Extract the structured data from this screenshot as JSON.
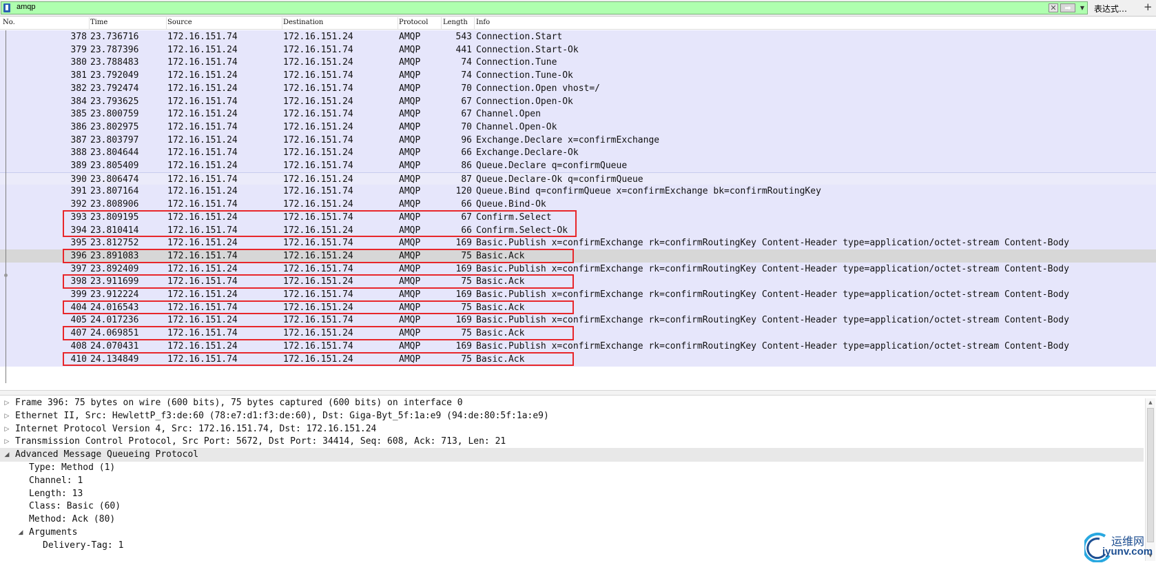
{
  "filter": {
    "value": "amqp",
    "clear_glyph": "✕",
    "apply_glyph": "➡",
    "history_glyph": "▼",
    "expression_label": "表达式…",
    "add_glyph": "+"
  },
  "columns": [
    "No.",
    "Time",
    "Source",
    "Destination",
    "Protocol",
    "Length",
    "Info"
  ],
  "packets": [
    {
      "no": "378",
      "time": "23.736716",
      "src": "172.16.151.74",
      "dst": "172.16.151.24",
      "proto": "AMQP",
      "len": "543",
      "info": "Connection.Start"
    },
    {
      "no": "379",
      "time": "23.787396",
      "src": "172.16.151.24",
      "dst": "172.16.151.74",
      "proto": "AMQP",
      "len": "441",
      "info": "Connection.Start-Ok"
    },
    {
      "no": "380",
      "time": "23.788483",
      "src": "172.16.151.74",
      "dst": "172.16.151.24",
      "proto": "AMQP",
      "len": "74",
      "info": "Connection.Tune"
    },
    {
      "no": "381",
      "time": "23.792049",
      "src": "172.16.151.24",
      "dst": "172.16.151.74",
      "proto": "AMQP",
      "len": "74",
      "info": "Connection.Tune-Ok"
    },
    {
      "no": "382",
      "time": "23.792474",
      "src": "172.16.151.24",
      "dst": "172.16.151.74",
      "proto": "AMQP",
      "len": "70",
      "info": "Connection.Open vhost=/"
    },
    {
      "no": "384",
      "time": "23.793625",
      "src": "172.16.151.74",
      "dst": "172.16.151.24",
      "proto": "AMQP",
      "len": "67",
      "info": "Connection.Open-Ok"
    },
    {
      "no": "385",
      "time": "23.800759",
      "src": "172.16.151.24",
      "dst": "172.16.151.74",
      "proto": "AMQP",
      "len": "67",
      "info": "Channel.Open"
    },
    {
      "no": "386",
      "time": "23.802975",
      "src": "172.16.151.74",
      "dst": "172.16.151.24",
      "proto": "AMQP",
      "len": "70",
      "info": "Channel.Open-Ok"
    },
    {
      "no": "387",
      "time": "23.803797",
      "src": "172.16.151.24",
      "dst": "172.16.151.74",
      "proto": "AMQP",
      "len": "96",
      "info": "Exchange.Declare x=confirmExchange"
    },
    {
      "no": "388",
      "time": "23.804644",
      "src": "172.16.151.74",
      "dst": "172.16.151.24",
      "proto": "AMQP",
      "len": "66",
      "info": "Exchange.Declare-Ok"
    },
    {
      "no": "389",
      "time": "23.805409",
      "src": "172.16.151.24",
      "dst": "172.16.151.74",
      "proto": "AMQP",
      "len": "86",
      "info": "Queue.Declare q=confirmQueue"
    },
    {
      "no": "390",
      "time": "23.806474",
      "src": "172.16.151.74",
      "dst": "172.16.151.24",
      "proto": "AMQP",
      "len": "87",
      "info": "Queue.Declare-Ok q=confirmQueue"
    },
    {
      "no": "391",
      "time": "23.807164",
      "src": "172.16.151.24",
      "dst": "172.16.151.74",
      "proto": "AMQP",
      "len": "120",
      "info": "Queue.Bind q=confirmQueue x=confirmExchange bk=confirmRoutingKey"
    },
    {
      "no": "392",
      "time": "23.808906",
      "src": "172.16.151.74",
      "dst": "172.16.151.24",
      "proto": "AMQP",
      "len": "66",
      "info": "Queue.Bind-Ok"
    },
    {
      "no": "393",
      "time": "23.809195",
      "src": "172.16.151.24",
      "dst": "172.16.151.74",
      "proto": "AMQP",
      "len": "67",
      "info": "Confirm.Select"
    },
    {
      "no": "394",
      "time": "23.810414",
      "src": "172.16.151.74",
      "dst": "172.16.151.24",
      "proto": "AMQP",
      "len": "66",
      "info": "Confirm.Select-Ok"
    },
    {
      "no": "395",
      "time": "23.812752",
      "src": "172.16.151.24",
      "dst": "172.16.151.74",
      "proto": "AMQP",
      "len": "169",
      "info": "Basic.Publish x=confirmExchange rk=confirmRoutingKey Content-Header type=application/octet-stream Content-Body"
    },
    {
      "no": "396",
      "time": "23.891083",
      "src": "172.16.151.74",
      "dst": "172.16.151.24",
      "proto": "AMQP",
      "len": "75",
      "info": "Basic.Ack"
    },
    {
      "no": "397",
      "time": "23.892409",
      "src": "172.16.151.24",
      "dst": "172.16.151.74",
      "proto": "AMQP",
      "len": "169",
      "info": "Basic.Publish x=confirmExchange rk=confirmRoutingKey Content-Header type=application/octet-stream Content-Body"
    },
    {
      "no": "398",
      "time": "23.911699",
      "src": "172.16.151.74",
      "dst": "172.16.151.24",
      "proto": "AMQP",
      "len": "75",
      "info": "Basic.Ack"
    },
    {
      "no": "399",
      "time": "23.912224",
      "src": "172.16.151.24",
      "dst": "172.16.151.74",
      "proto": "AMQP",
      "len": "169",
      "info": "Basic.Publish x=confirmExchange rk=confirmRoutingKey Content-Header type=application/octet-stream Content-Body"
    },
    {
      "no": "404",
      "time": "24.016543",
      "src": "172.16.151.74",
      "dst": "172.16.151.24",
      "proto": "AMQP",
      "len": "75",
      "info": "Basic.Ack"
    },
    {
      "no": "405",
      "time": "24.017236",
      "src": "172.16.151.24",
      "dst": "172.16.151.74",
      "proto": "AMQP",
      "len": "169",
      "info": "Basic.Publish x=confirmExchange rk=confirmRoutingKey Content-Header type=application/octet-stream Content-Body"
    },
    {
      "no": "407",
      "time": "24.069851",
      "src": "172.16.151.74",
      "dst": "172.16.151.24",
      "proto": "AMQP",
      "len": "75",
      "info": "Basic.Ack"
    },
    {
      "no": "408",
      "time": "24.070431",
      "src": "172.16.151.24",
      "dst": "172.16.151.74",
      "proto": "AMQP",
      "len": "169",
      "info": "Basic.Publish x=confirmExchange rk=confirmRoutingKey Content-Header type=application/octet-stream Content-Body"
    },
    {
      "no": "410",
      "time": "24.134849",
      "src": "172.16.151.74",
      "dst": "172.16.151.24",
      "proto": "AMQP",
      "len": "75",
      "info": "Basic.Ack"
    }
  ],
  "current_packet_no": "390",
  "selected_packet_no": "396",
  "highlighted_rows": [
    "393",
    "394",
    "396",
    "398",
    "404",
    "407",
    "410"
  ],
  "details": [
    {
      "text": "Frame 396: 75 bytes on wire (600 bits), 75 bytes captured (600 bits) on interface 0",
      "depth": 0,
      "expander": "collapsed"
    },
    {
      "text": "Ethernet II, Src: HewlettP_f3:de:60 (78:e7:d1:f3:de:60), Dst: Giga-Byt_5f:1a:e9 (94:de:80:5f:1a:e9)",
      "depth": 0,
      "expander": "collapsed"
    },
    {
      "text": "Internet Protocol Version 4, Src: 172.16.151.74, Dst: 172.16.151.24",
      "depth": 0,
      "expander": "collapsed"
    },
    {
      "text": "Transmission Control Protocol, Src Port: 5672, Dst Port: 34414, Seq: 608, Ack: 713, Len: 21",
      "depth": 0,
      "expander": "collapsed"
    },
    {
      "text": "Advanced Message Queueing Protocol",
      "depth": 0,
      "expander": "expanded",
      "selected": true
    },
    {
      "text": "Type: Method (1)",
      "depth": 1,
      "expander": "none"
    },
    {
      "text": "Channel: 1",
      "depth": 1,
      "expander": "none"
    },
    {
      "text": "Length: 13",
      "depth": 1,
      "expander": "none"
    },
    {
      "text": "Class: Basic (60)",
      "depth": 1,
      "expander": "none"
    },
    {
      "text": "Method: Ack (80)",
      "depth": 1,
      "expander": "none"
    },
    {
      "text": "Arguments",
      "depth": 1,
      "expander": "expanded"
    },
    {
      "text": "Delivery-Tag: 1",
      "depth": 2,
      "expander": "none"
    }
  ],
  "icons": {
    "collapsed": "▷",
    "expanded": "◢",
    "scroll_up": "▲",
    "scroll_down": "▼"
  },
  "colors": {
    "filter_valid": "#afffaf",
    "row_background": "#e6e6fb",
    "selected_row": "#d7d7d7",
    "annotation_box": "#e8262a"
  },
  "watermark": {
    "line1": "运维网",
    "line2": "iyunv.com"
  }
}
